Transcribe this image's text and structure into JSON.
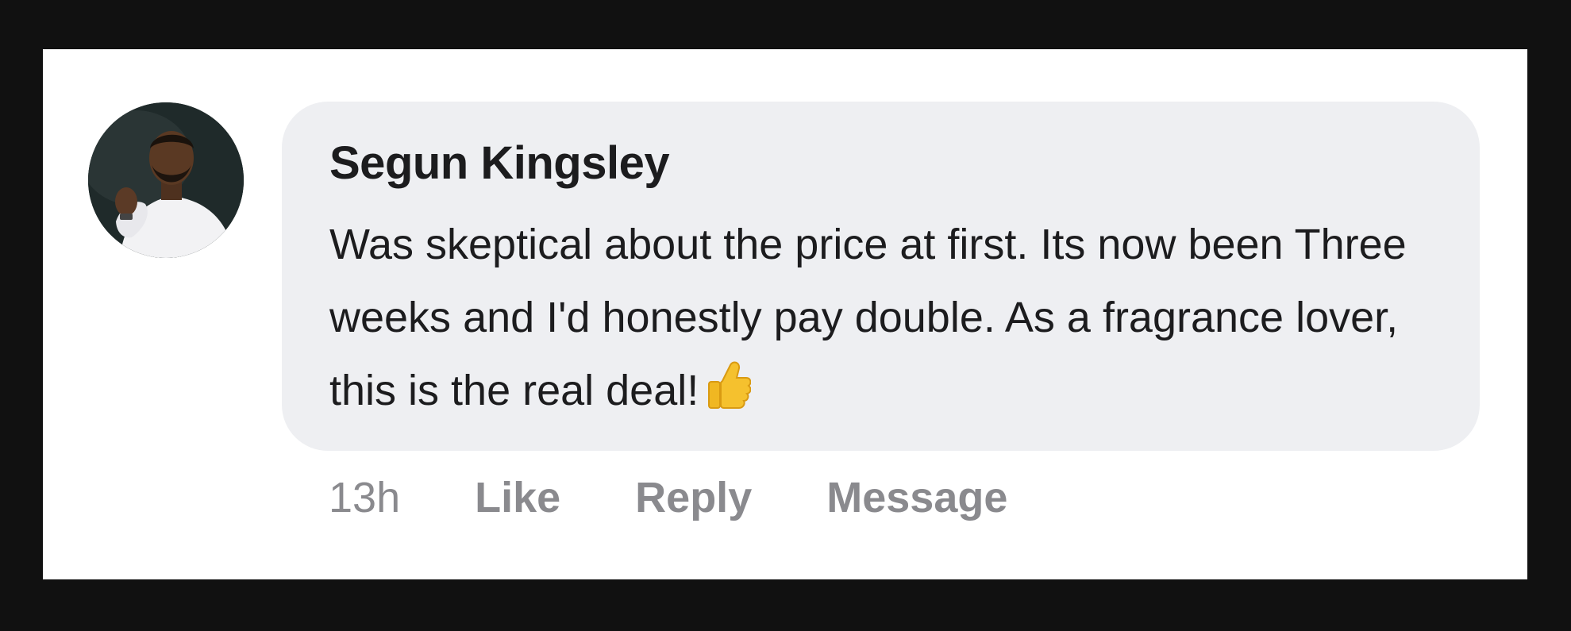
{
  "comment": {
    "author": "Segun Kingsley",
    "text": "Was skeptical about the price at first. Its now been Three weeks and I'd honestly pay double. As a fragrance lover, this is the real deal!",
    "emoji_icon": "thumbs-up-icon"
  },
  "actions": {
    "time": "13h",
    "like": "Like",
    "reply": "Reply",
    "message": "Message"
  },
  "colors": {
    "background": "#111111",
    "card": "#ffffff",
    "bubble": "#eeeff2",
    "text": "#1c1c1e",
    "meta": "#8a8a8e"
  }
}
